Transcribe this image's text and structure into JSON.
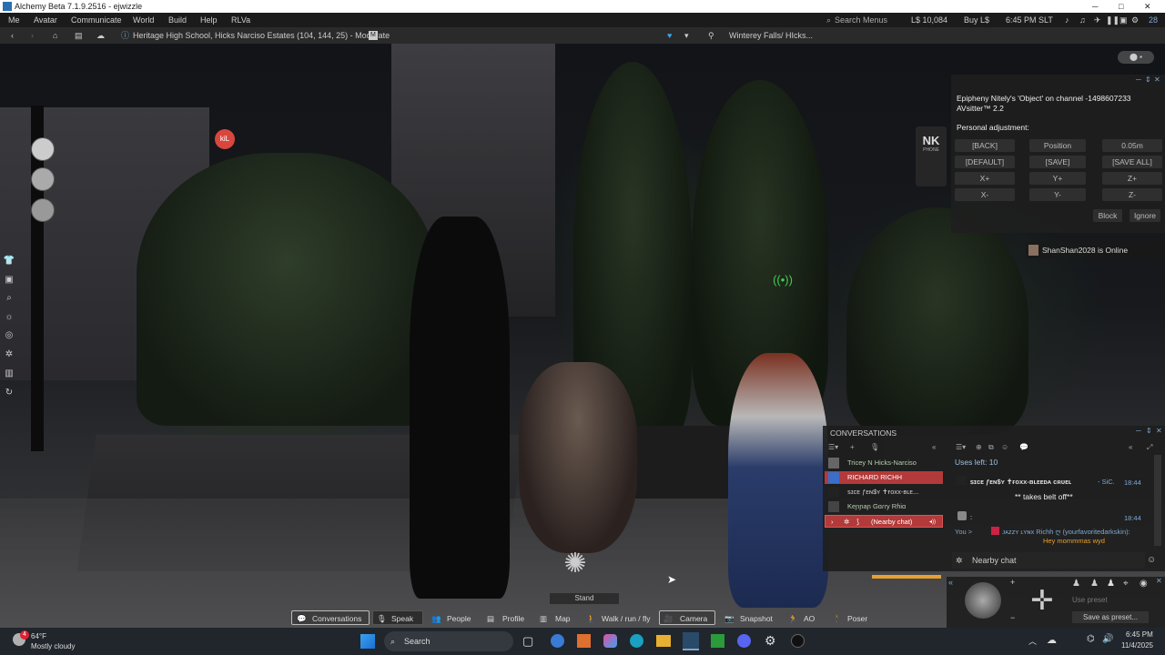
{
  "window": {
    "title": "Alchemy Beta 7.1.9.2516 - ejwizzle",
    "min": "─",
    "max": "□",
    "close": "✕"
  },
  "menu": [
    "Me",
    "Avatar",
    "Communicate",
    "World",
    "Build",
    "Help",
    "RLVa"
  ],
  "status": {
    "search_placeholder": "Search Menus",
    "balance": "L$ 10,084",
    "buy": "Buy L$",
    "time": "6:45 PM SLT",
    "fps": "28"
  },
  "nav": {
    "location": "Heritage High School, Hicks Narciso Estates (104, 144, 25) - Moderate",
    "maturity_badge": "M",
    "parcel_right": "Winterey Falls/ HIcks..."
  },
  "avsitter": {
    "header": "Epipheny Nitely's 'Object' on channel -1498607233",
    "version": "AVsitter™ 2.2",
    "subheading": "Personal adjustment:",
    "buttons": [
      [
        "[BACK]",
        "Position",
        "0.05m"
      ],
      [
        "[DEFAULT]",
        "[SAVE]",
        "[SAVE ALL]"
      ],
      [
        "X+",
        "Y+",
        "Z+"
      ],
      [
        "X-",
        "Y-",
        "Z-"
      ]
    ],
    "block": "Block",
    "ignore": "Ignore"
  },
  "nk_badge": {
    "top": "NK",
    "bottom": "PHONE"
  },
  "notification": "ShanShan2028 is Online",
  "hud": {
    "tag": "kiL",
    "stand": "Stand"
  },
  "conversations": {
    "title": "CONVERSATIONS",
    "list": [
      {
        "name": "Tricey N Hicks-Narciso",
        "style": "normal"
      },
      {
        "name": "RICHARD RICHH",
        "style": "selected"
      },
      {
        "name": "ꜱɪᴄᴇ ƒᴇɴ$ʏ ✝ғᴏxx-ʙʟᴇ...",
        "style": "normal"
      },
      {
        "name": "Keɲɲaɲ Gɑɾɾy Rɦiɑ",
        "style": "normal"
      },
      {
        "name": "(Nearby chat)",
        "style": "nearby"
      }
    ],
    "uses_left": "Uses left: 10",
    "messages": [
      {
        "name": "ꜱɪᴄᴇ ƒᴇɴ$ʏ ✝ғᴏxx-ʙʟᴇᴇᴅᴀ ᴄʀᴜᴇʟ",
        "tag": "- SiC.",
        "time": "18:44",
        "text": "** takes belt off**"
      },
      {
        "name": "",
        "tag": ":",
        "time": "18:44",
        "text": ""
      },
      {
        "name": "You > ",
        "tag": "ᴊᴀᴢᴢʏ ʟʏɴx  Richh ღ (yourfavoritedarkskin):",
        "time": "",
        "text": "Hey mommmas wyd"
      }
    ],
    "input_placeholder": "Nearby chat"
  },
  "movement": {
    "preset_placeholder": "Use preset",
    "save_preset": "Save as preset..."
  },
  "toolbar": [
    "Conversations",
    "Speak",
    "People",
    "Profile",
    "Map",
    "Walk / run / fly",
    "Camera",
    "Snapshot",
    "AO",
    "Poser"
  ],
  "taskbar": {
    "weather_temp": "64°F",
    "weather_desc": "Mostly cloudy",
    "weather_badge": "4",
    "search": "Search",
    "clock_time": "6:45 PM",
    "clock_date": "11/4/2025"
  }
}
